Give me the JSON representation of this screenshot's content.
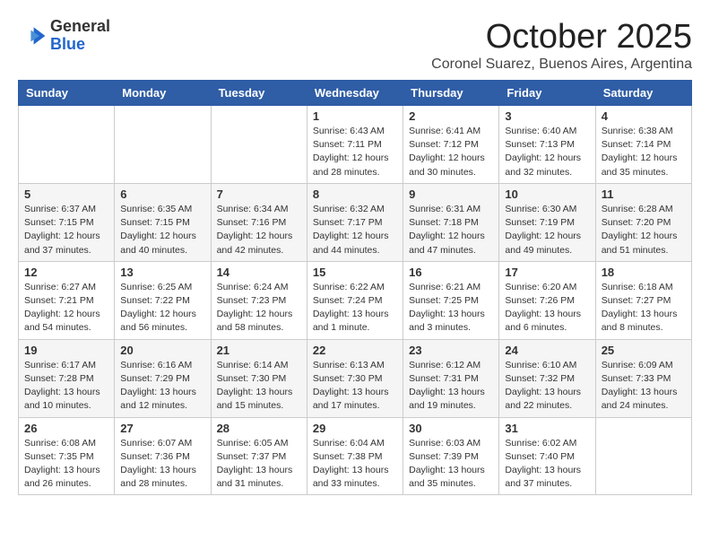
{
  "logo": {
    "general": "General",
    "blue": "Blue"
  },
  "title": "October 2025",
  "location": "Coronel Suarez, Buenos Aires, Argentina",
  "weekdays": [
    "Sunday",
    "Monday",
    "Tuesday",
    "Wednesday",
    "Thursday",
    "Friday",
    "Saturday"
  ],
  "weeks": [
    [
      {
        "day": "",
        "info": ""
      },
      {
        "day": "",
        "info": ""
      },
      {
        "day": "",
        "info": ""
      },
      {
        "day": "1",
        "info": "Sunrise: 6:43 AM\nSunset: 7:11 PM\nDaylight: 12 hours\nand 28 minutes."
      },
      {
        "day": "2",
        "info": "Sunrise: 6:41 AM\nSunset: 7:12 PM\nDaylight: 12 hours\nand 30 minutes."
      },
      {
        "day": "3",
        "info": "Sunrise: 6:40 AM\nSunset: 7:13 PM\nDaylight: 12 hours\nand 32 minutes."
      },
      {
        "day": "4",
        "info": "Sunrise: 6:38 AM\nSunset: 7:14 PM\nDaylight: 12 hours\nand 35 minutes."
      }
    ],
    [
      {
        "day": "5",
        "info": "Sunrise: 6:37 AM\nSunset: 7:15 PM\nDaylight: 12 hours\nand 37 minutes."
      },
      {
        "day": "6",
        "info": "Sunrise: 6:35 AM\nSunset: 7:15 PM\nDaylight: 12 hours\nand 40 minutes."
      },
      {
        "day": "7",
        "info": "Sunrise: 6:34 AM\nSunset: 7:16 PM\nDaylight: 12 hours\nand 42 minutes."
      },
      {
        "day": "8",
        "info": "Sunrise: 6:32 AM\nSunset: 7:17 PM\nDaylight: 12 hours\nand 44 minutes."
      },
      {
        "day": "9",
        "info": "Sunrise: 6:31 AM\nSunset: 7:18 PM\nDaylight: 12 hours\nand 47 minutes."
      },
      {
        "day": "10",
        "info": "Sunrise: 6:30 AM\nSunset: 7:19 PM\nDaylight: 12 hours\nand 49 minutes."
      },
      {
        "day": "11",
        "info": "Sunrise: 6:28 AM\nSunset: 7:20 PM\nDaylight: 12 hours\nand 51 minutes."
      }
    ],
    [
      {
        "day": "12",
        "info": "Sunrise: 6:27 AM\nSunset: 7:21 PM\nDaylight: 12 hours\nand 54 minutes."
      },
      {
        "day": "13",
        "info": "Sunrise: 6:25 AM\nSunset: 7:22 PM\nDaylight: 12 hours\nand 56 minutes."
      },
      {
        "day": "14",
        "info": "Sunrise: 6:24 AM\nSunset: 7:23 PM\nDaylight: 12 hours\nand 58 minutes."
      },
      {
        "day": "15",
        "info": "Sunrise: 6:22 AM\nSunset: 7:24 PM\nDaylight: 13 hours\nand 1 minute."
      },
      {
        "day": "16",
        "info": "Sunrise: 6:21 AM\nSunset: 7:25 PM\nDaylight: 13 hours\nand 3 minutes."
      },
      {
        "day": "17",
        "info": "Sunrise: 6:20 AM\nSunset: 7:26 PM\nDaylight: 13 hours\nand 6 minutes."
      },
      {
        "day": "18",
        "info": "Sunrise: 6:18 AM\nSunset: 7:27 PM\nDaylight: 13 hours\nand 8 minutes."
      }
    ],
    [
      {
        "day": "19",
        "info": "Sunrise: 6:17 AM\nSunset: 7:28 PM\nDaylight: 13 hours\nand 10 minutes."
      },
      {
        "day": "20",
        "info": "Sunrise: 6:16 AM\nSunset: 7:29 PM\nDaylight: 13 hours\nand 12 minutes."
      },
      {
        "day": "21",
        "info": "Sunrise: 6:14 AM\nSunset: 7:30 PM\nDaylight: 13 hours\nand 15 minutes."
      },
      {
        "day": "22",
        "info": "Sunrise: 6:13 AM\nSunset: 7:30 PM\nDaylight: 13 hours\nand 17 minutes."
      },
      {
        "day": "23",
        "info": "Sunrise: 6:12 AM\nSunset: 7:31 PM\nDaylight: 13 hours\nand 19 minutes."
      },
      {
        "day": "24",
        "info": "Sunrise: 6:10 AM\nSunset: 7:32 PM\nDaylight: 13 hours\nand 22 minutes."
      },
      {
        "day": "25",
        "info": "Sunrise: 6:09 AM\nSunset: 7:33 PM\nDaylight: 13 hours\nand 24 minutes."
      }
    ],
    [
      {
        "day": "26",
        "info": "Sunrise: 6:08 AM\nSunset: 7:35 PM\nDaylight: 13 hours\nand 26 minutes."
      },
      {
        "day": "27",
        "info": "Sunrise: 6:07 AM\nSunset: 7:36 PM\nDaylight: 13 hours\nand 28 minutes."
      },
      {
        "day": "28",
        "info": "Sunrise: 6:05 AM\nSunset: 7:37 PM\nDaylight: 13 hours\nand 31 minutes."
      },
      {
        "day": "29",
        "info": "Sunrise: 6:04 AM\nSunset: 7:38 PM\nDaylight: 13 hours\nand 33 minutes."
      },
      {
        "day": "30",
        "info": "Sunrise: 6:03 AM\nSunset: 7:39 PM\nDaylight: 13 hours\nand 35 minutes."
      },
      {
        "day": "31",
        "info": "Sunrise: 6:02 AM\nSunset: 7:40 PM\nDaylight: 13 hours\nand 37 minutes."
      },
      {
        "day": "",
        "info": ""
      }
    ]
  ]
}
